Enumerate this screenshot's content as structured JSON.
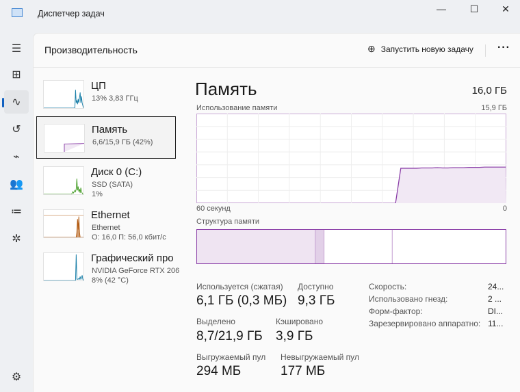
{
  "window": {
    "title": "Диспетчер задач",
    "minimize": "—",
    "maximize": "☐",
    "close": "✕"
  },
  "header": {
    "title": "Производительность",
    "run_task": "Запустить новую задачу",
    "more": "···"
  },
  "devices": [
    {
      "name": "ЦП",
      "sub1": "13% 3,83 ГГц",
      "sub2": "",
      "color": "#1a7fa8",
      "graph": [
        0,
        0,
        0,
        0,
        0,
        0,
        0,
        0,
        0,
        0,
        0,
        0,
        0,
        0,
        0,
        0,
        0,
        0,
        0,
        0,
        0,
        0,
        0,
        0,
        0,
        0,
        0,
        0,
        0,
        0,
        0,
        0,
        0,
        0,
        0,
        0,
        0,
        0,
        0,
        0,
        0,
        0,
        0,
        0,
        0,
        0,
        0,
        0,
        0.7,
        0.2,
        0.3,
        0.15,
        0.35,
        0.2,
        0.4,
        0.6,
        0.2,
        0.45,
        0.2,
        0.1
      ]
    },
    {
      "name": "Память",
      "sub1": "6,6/15,9 ГБ (42%)",
      "sub2": "",
      "color": "#8b3fa8",
      "graph": []
    },
    {
      "name": "Диск 0 (C:)",
      "sub1": "SSD (SATA)",
      "sub2": "1%",
      "color": "#4aa02c",
      "graph": [
        0,
        0,
        0,
        0,
        0,
        0,
        0,
        0,
        0,
        0,
        0,
        0,
        0,
        0,
        0,
        0,
        0,
        0,
        0,
        0,
        0,
        0,
        0,
        0,
        0,
        0,
        0,
        0,
        0,
        0,
        0,
        0,
        0,
        0,
        0,
        0,
        0,
        0,
        0,
        0,
        0,
        0,
        0,
        0.05,
        0.1,
        0.05,
        0.1,
        0.15,
        0.1,
        0.2,
        0.6,
        0.15,
        0.3,
        0.1,
        0.2,
        0.05,
        0.25,
        0.1,
        0.05,
        0
      ]
    },
    {
      "name": "Ethernet",
      "sub1": "Ethernet",
      "sub2": "О: 16,0 П: 56,0 кбит/с",
      "color": "#b25a10",
      "graph": [
        0,
        0,
        0,
        0,
        0,
        0,
        0,
        0,
        0,
        0,
        0,
        0,
        0,
        0,
        0,
        0,
        0,
        0,
        0,
        0,
        0,
        0,
        0,
        0,
        0,
        0,
        0,
        0,
        0,
        0,
        0,
        0,
        0,
        0,
        0,
        0,
        0,
        0,
        0,
        0,
        0,
        0,
        0,
        0,
        0,
        0,
        0,
        0,
        0,
        0,
        0.2,
        0.7,
        0.3,
        0.8,
        0.2,
        0,
        0,
        0,
        0,
        0
      ]
    },
    {
      "name": "Графический про",
      "sub1": "NVIDIA GeForce RTX 206",
      "sub2": "8% (42 °C)",
      "color": "#1a7fa8",
      "graph": [
        0,
        0,
        0,
        0,
        0,
        0,
        0,
        0,
        0,
        0,
        0,
        0,
        0,
        0,
        0,
        0,
        0,
        0,
        0,
        0,
        0,
        0,
        0,
        0,
        0,
        0,
        0,
        0,
        0,
        0,
        0,
        0,
        0,
        0,
        0,
        0,
        0,
        0,
        0,
        0,
        0,
        0,
        0,
        0,
        0,
        0,
        0,
        0,
        0,
        1,
        0.05,
        0.05,
        0.05,
        0.08,
        0.05,
        0.15,
        0.05,
        0.1,
        0.2,
        0.05
      ]
    }
  ],
  "memory": {
    "title": "Память",
    "total": "16,0 ГБ",
    "usage_label": "Использование памяти",
    "usage_max": "15,9 ГБ",
    "time_left": "60 секунд",
    "time_right": "0",
    "composition_label": "Структура памяти",
    "composition": {
      "in_use": 6.1,
      "modified": 0.45,
      "standby": 3.5,
      "free": 5.85
    },
    "usage_history_gb": [
      null,
      null,
      null,
      null,
      null,
      null,
      null,
      null,
      null,
      null,
      null,
      null,
      null,
      null,
      null,
      null,
      null,
      null,
      null,
      null,
      null,
      null,
      null,
      null,
      null,
      null,
      null,
      null,
      null,
      null,
      null,
      null,
      null,
      null,
      null,
      null,
      null,
      null,
      0,
      6.2,
      6.2,
      6.2,
      6.2,
      6.25,
      6.25,
      6.25,
      6.3,
      6.25,
      6.25,
      6.3,
      6.3,
      6.3,
      6.35,
      6.35,
      6.35,
      6.4,
      6.4,
      6.4,
      6.4,
      6.4
    ],
    "stats": [
      {
        "label": "Используется (сжатая)",
        "value": "6,1 ГБ (0,3 МБ)"
      },
      {
        "label": "Доступно",
        "value": "9,3 ГБ"
      },
      {
        "label": "Выделено",
        "value": "8,7/21,9 ГБ"
      },
      {
        "label": "Кэшировано",
        "value": "3,9 ГБ"
      },
      {
        "label": "Выгружаемый пул",
        "value": "294 МБ"
      },
      {
        "label": "Невыгружаемый пул",
        "value": "177 МБ"
      }
    ],
    "props": [
      {
        "label": "Скорость:",
        "value": "24..."
      },
      {
        "label": "Использовано гнезд:",
        "value": "2 ..."
      },
      {
        "label": "Форм-фактор:",
        "value": "DI..."
      },
      {
        "label": "Зарезервировано аппаратно:",
        "value": "11..."
      }
    ]
  }
}
